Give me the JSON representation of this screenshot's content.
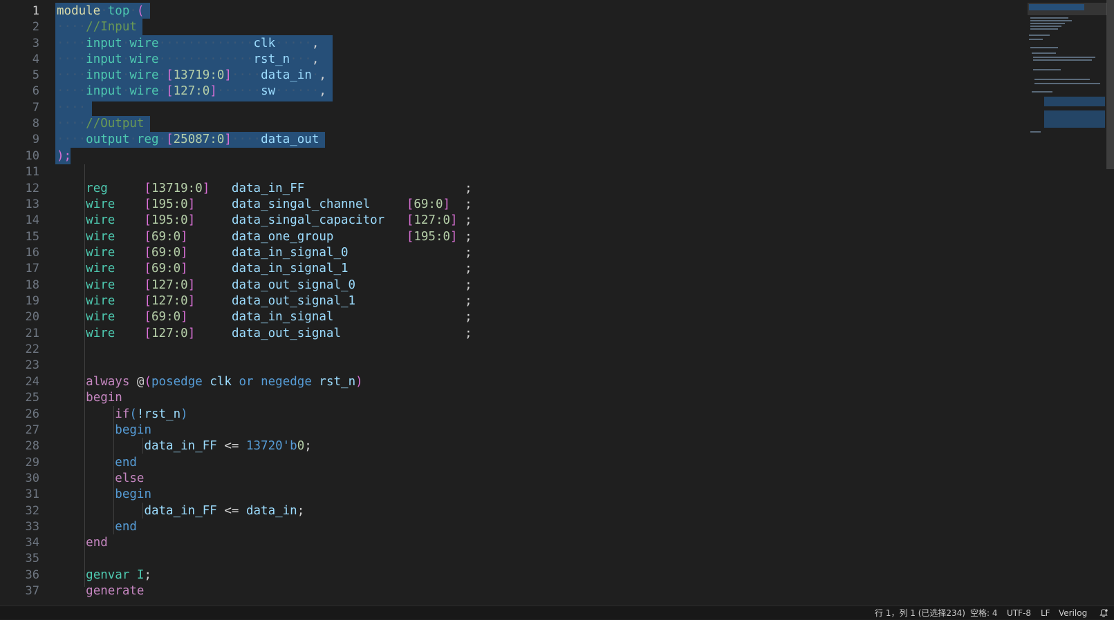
{
  "editor": {
    "language": "Verilog",
    "line_numbers": [
      "1",
      "2",
      "3",
      "4",
      "5",
      "6",
      "7",
      "8",
      "9",
      "10",
      "11",
      "12",
      "13",
      "14",
      "15",
      "16",
      "17",
      "18",
      "19",
      "20",
      "21",
      "22",
      "23",
      "24",
      "25",
      "26",
      "27",
      "28",
      "29",
      "30",
      "31",
      "32",
      "33",
      "34",
      "35",
      "36",
      "37"
    ],
    "code": {
      "l1": {
        "a": "module",
        "b": "top",
        "c": "("
      },
      "l2": {
        "a": "//Input"
      },
      "l3": {
        "a": "input",
        "b": "wire",
        "c": "clk",
        "d": ","
      },
      "l4": {
        "a": "input",
        "b": "wire",
        "c": "rst_n",
        "d": ","
      },
      "l5": {
        "a": "input",
        "b": "wire",
        "c": "[",
        "d": "13719:0",
        "e": "]",
        "f": "data_in",
        "g": ","
      },
      "l6": {
        "a": "input",
        "b": "wire",
        "c": "[",
        "d": "127:0",
        "e": "]",
        "f": "sw",
        "g": ","
      },
      "l8": {
        "a": "//Output"
      },
      "l9": {
        "a": "output",
        "b": "reg",
        "c": "[",
        "d": "25087:0",
        "e": "]",
        "f": "data_out"
      },
      "l10": {
        "a": ");"
      },
      "l12": {
        "a": "reg",
        "b": "[",
        "c": "13719:0",
        "d": "]",
        "e": "data_in_FF",
        "f": ";"
      },
      "l13": {
        "a": "wire",
        "b": "[",
        "c": "195:0",
        "d": "]",
        "e": "data_singal_channel",
        "f": "[",
        "g": "69:0",
        "h": "]",
        "i": ";"
      },
      "l14": {
        "a": "wire",
        "b": "[",
        "c": "195:0",
        "d": "]",
        "e": "data_singal_capacitor",
        "f": "[",
        "g": "127:0",
        "h": "]",
        "i": ";"
      },
      "l15": {
        "a": "wire",
        "b": "[",
        "c": "69:0",
        "d": "]",
        "e": "data_one_group",
        "f": "[",
        "g": "195:0",
        "h": "]",
        "i": ";"
      },
      "l16": {
        "a": "wire",
        "b": "[",
        "c": "69:0",
        "d": "]",
        "e": "data_in_signal_0",
        "f": ";"
      },
      "l17": {
        "a": "wire",
        "b": "[",
        "c": "69:0",
        "d": "]",
        "e": "data_in_signal_1",
        "f": ";"
      },
      "l18": {
        "a": "wire",
        "b": "[",
        "c": "127:0",
        "d": "]",
        "e": "data_out_signal_0",
        "f": ";"
      },
      "l19": {
        "a": "wire",
        "b": "[",
        "c": "127:0",
        "d": "]",
        "e": "data_out_signal_1",
        "f": ";"
      },
      "l20": {
        "a": "wire",
        "b": "[",
        "c": "69:0",
        "d": "]",
        "e": "data_in_signal",
        "f": ";"
      },
      "l21": {
        "a": "wire",
        "b": "[",
        "c": "127:0",
        "d": "]",
        "e": "data_out_signal",
        "f": ";"
      },
      "l24": {
        "a": "always",
        "b": "@",
        "c": "(",
        "d": "posedge",
        "e": "clk",
        "f": "or",
        "g": "negedge",
        "h": "rst_n",
        "i": ")"
      },
      "l25": {
        "a": "begin"
      },
      "l26": {
        "a": "if",
        "b": "(",
        "c": "!rst_n",
        "d": ")"
      },
      "l27": {
        "a": "begin"
      },
      "l28": {
        "a": "data_in_FF",
        "b": "<=",
        "c": "13720'b",
        "d": "0",
        "e": ";"
      },
      "l29": {
        "a": "end"
      },
      "l30": {
        "a": "else"
      },
      "l31": {
        "a": "begin"
      },
      "l32": {
        "a": "data_in_FF",
        "b": "<=",
        "c": "data_in",
        "d": ";"
      },
      "l33": {
        "a": "end"
      },
      "l34": {
        "a": "end"
      },
      "l36": {
        "a": "genvar",
        "b": "I",
        "c": ";"
      },
      "l37": {
        "a": "generate"
      }
    }
  },
  "status_bar": {
    "cursor_position": "行 1，列 1 (已选择234)",
    "indentation": "空格: 4",
    "encoding": "UTF-8",
    "eol": "LF",
    "language_mode": "Verilog"
  },
  "colors": {
    "background": "#1f1f1f",
    "selection": "#264f78",
    "keyword_purple": "#c586c0",
    "keyword_blue": "#569cd6",
    "type_teal": "#4ec9b0",
    "identifier": "#9cdcfe",
    "number": "#b5cea8",
    "comment": "#6a9955"
  }
}
